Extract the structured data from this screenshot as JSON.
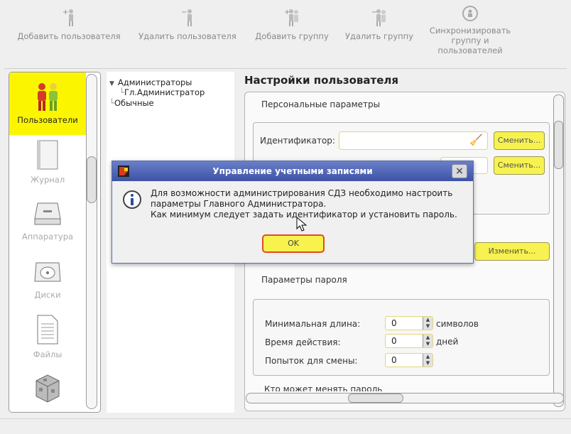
{
  "toolbar": {
    "add_user": "Добавить пользователя",
    "delete_user": "Удалить пользователя",
    "add_group": "Добавить группу",
    "delete_group": "Удалить группу",
    "sync_line1": "Синхронизировать",
    "sync_line2": "группу и",
    "sync_line3": "пользователей"
  },
  "nav": {
    "users": "Пользователи",
    "journal": "Журнал",
    "hardware": "Аппаратура",
    "disks": "Диски",
    "files": "Файлы"
  },
  "tree": {
    "group1": "Администраторы",
    "child1": "Гл.Администратор",
    "group2": "Обычные"
  },
  "settings": {
    "title": "Настройки пользователя",
    "personal_params": "Персональные параметры",
    "identifier_label": "Идентификатор:",
    "change_button": "Сменить...",
    "change_button2": "Сменить...",
    "edit_button": "Изменить...",
    "password_params": "Параметры пароля",
    "min_length_label": "Минимальная длина:",
    "min_length_value": "0",
    "min_length_unit": "символов",
    "validity_label": "Время действия:",
    "validity_value": "0",
    "validity_unit": "дней",
    "attempts_label": "Попыток для смены:",
    "attempts_value": "0",
    "who_can_change": "Кто может менять пароль"
  },
  "dialog": {
    "title": "Управление учетными записями",
    "close": "×",
    "message_line1": "Для возможности администрирования СДЗ необходимо настроить",
    "message_line2": "параметры Главного Администратора.",
    "message_line3": "Как минимум следует задать идентификатор и установить пароль.",
    "ok": "OK"
  },
  "colors": {
    "accent_yellow": "#fbf600",
    "dialog_title": "#4a5db0",
    "ok_border": "#e24c1f"
  }
}
